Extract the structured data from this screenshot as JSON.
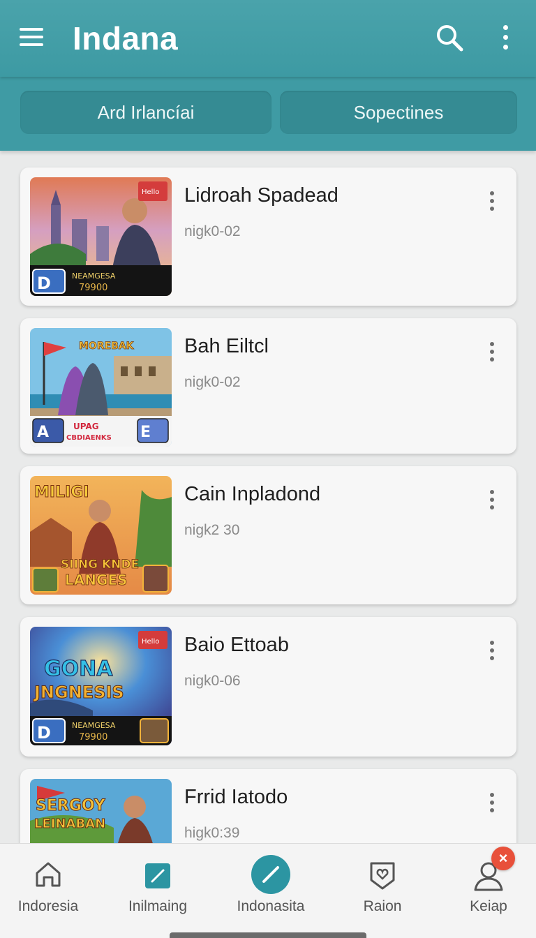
{
  "app_bar": {
    "title": "Indana",
    "menu_icon": "hamburger-menu-icon",
    "search_icon": "search-icon",
    "more_icon": "more-vertical-icon"
  },
  "filters": [
    "Ard Irlancíai",
    "Sopectines"
  ],
  "items": [
    {
      "title": "Lidroah Spadead",
      "subtitle": "nigk0-02",
      "thumb": {
        "texts": [
          "NEAMGESA",
          "79900"
        ],
        "badge_left": "D",
        "sticker": "Hello"
      }
    },
    {
      "title": "Bah Eiltcl",
      "subtitle": "nigk0-02",
      "thumb": {
        "texts": [
          "MOREBAK",
          "UPAG",
          "CBDIAENKS"
        ],
        "badge_left": "A",
        "badge_right": "E"
      }
    },
    {
      "title": "Cain Inpladond",
      "subtitle": "nigk2 30",
      "thumb": {
        "texts": [
          "MILIGI",
          "SIING KNDE",
          "LANGES"
        ]
      }
    },
    {
      "title": "Baio Ettoab",
      "subtitle": "nigk0-06",
      "thumb": {
        "texts": [
          "GONA",
          "JNGNESIS",
          "NEAMGESA",
          "79900"
        ],
        "badge_left": "D",
        "sticker": "Hello"
      }
    },
    {
      "title": "Frrid Iatodo",
      "subtitle": "higk0:39",
      "thumb": {
        "texts": [
          "SERGOY",
          "LEINABAN"
        ]
      }
    }
  ],
  "bottom_nav": [
    {
      "label": "Indoresia",
      "icon": "home-icon"
    },
    {
      "label": "Inilmaing",
      "icon": "edit-square-icon"
    },
    {
      "label": "Indonasita",
      "icon": "pencil-circle-icon"
    },
    {
      "label": "Raion",
      "icon": "shield-heart-icon"
    },
    {
      "label": "Keiap",
      "icon": "person-icon"
    }
  ],
  "notification_badge": "×",
  "colors": {
    "app_bar": "#3d9aa3",
    "chip": "#358b93",
    "accent": "#2c95a2",
    "badge": "#e8503a"
  }
}
